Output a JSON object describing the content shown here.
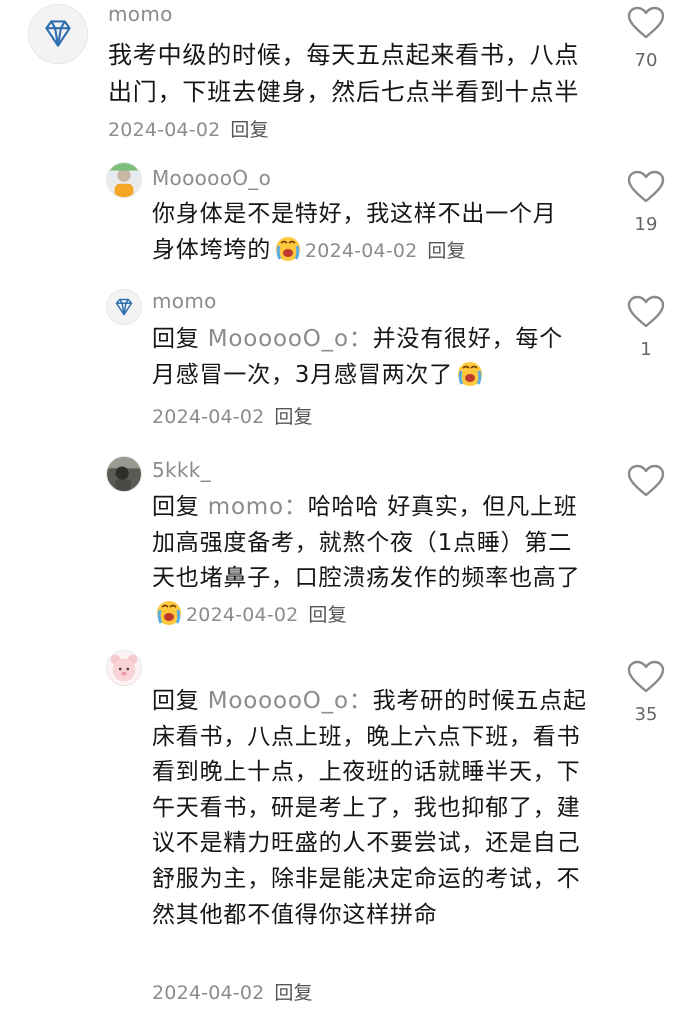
{
  "comments": [
    {
      "username": "momo",
      "text": "我考中级的时候，每天五点起来看书，八点出门，下班去健身，然后七点半看到十点半",
      "date": "2024-04-02",
      "reply_label": "回复",
      "likes": "70",
      "avatar_icon": "diamond-icon"
    },
    {
      "username": "MoooooO_o",
      "text": "你身体是不是特好，我这样不出一个月 身体垮垮的",
      "emoji": "crying-face-icon",
      "date": "2024-04-02",
      "reply_label": "回复",
      "likes": "19",
      "avatar_icon": "photo-avatar"
    },
    {
      "username": "momo",
      "reply_prefix": "回复",
      "reply_to": "MoooooO_o：",
      "text": "并没有很好，每个月感冒一次，3月感冒两次了",
      "emoji": "crying-face-icon",
      "date": "2024-04-02",
      "reply_label": "回复",
      "likes": "1",
      "avatar_icon": "diamond-icon"
    },
    {
      "username": "5kkk_",
      "reply_prefix": "回复",
      "reply_to": "momo：",
      "text": "哈哈哈 好真实，但凡上班加高强度备考，就熬个夜（1点睡）第二天也堵鼻子，口腔溃疡发作的频率也高了",
      "emoji": "crying-face-icon",
      "date": "2024-04-02",
      "reply_label": "回复",
      "likes": "",
      "avatar_icon": "photo-avatar"
    },
    {
      "username": "",
      "reply_prefix": "回复",
      "reply_to": "MoooooO_o：",
      "text": "我考研的时候五点起床看书，八点上班，晚上六点下班，看书看到晚上十点，上夜班的话就睡半天，下午天看书，研是考上了，我也抑郁了，建议不是精力旺盛的人不要尝试，还是自己舒服为主，除非是能决定命运的考试，不然其他都不值得你这样拼命",
      "date": "2024-04-02",
      "reply_label": "回复",
      "likes": "35",
      "avatar_icon": "pink-bear-avatar"
    }
  ],
  "colors": {
    "username": "#8c8c8c",
    "text": "#161616",
    "heart_stroke": "#8a8a8a"
  }
}
